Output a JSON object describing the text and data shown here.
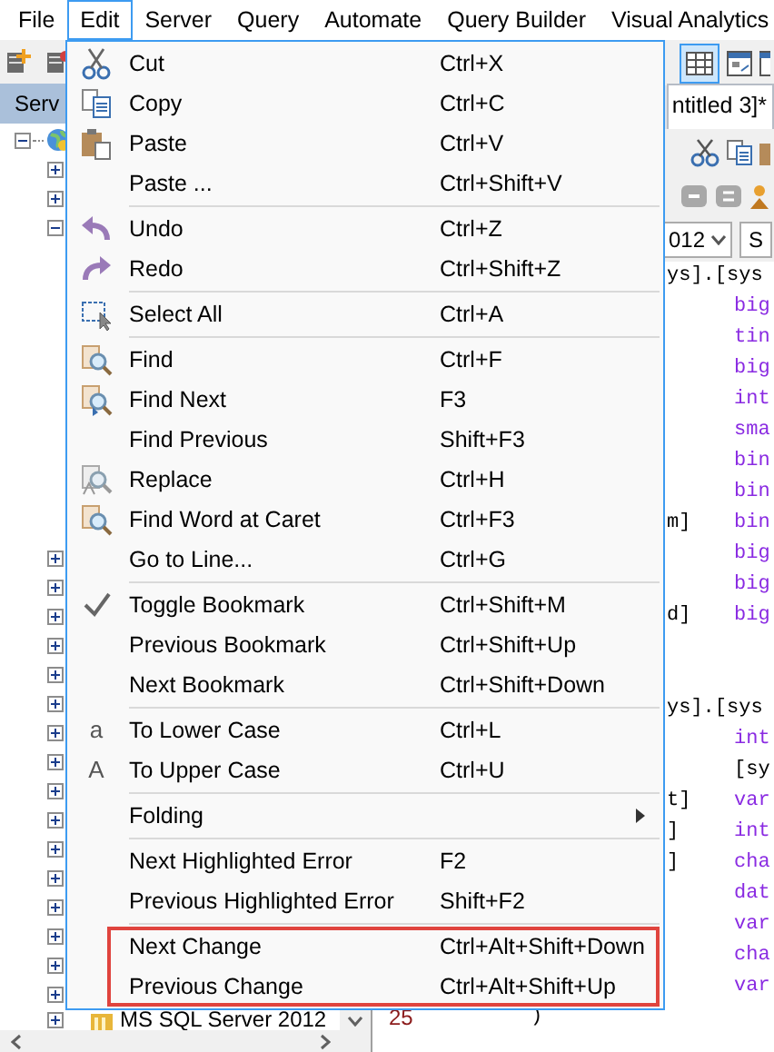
{
  "menubar": [
    {
      "label": "File",
      "selected": false
    },
    {
      "label": "Edit",
      "selected": true
    },
    {
      "label": "Server",
      "selected": false
    },
    {
      "label": "Query",
      "selected": false
    },
    {
      "label": "Automate",
      "selected": false
    },
    {
      "label": "Query Builder",
      "selected": false
    },
    {
      "label": "Visual Analytics",
      "selected": false
    }
  ],
  "left_panel": {
    "tab": "Serv",
    "tree": {
      "expanded": true,
      "children": [
        {
          "expanded": false
        },
        {
          "expanded": false
        },
        {
          "expanded": true
        },
        {
          "expanded": false
        },
        {
          "expanded": false
        },
        {
          "expanded": false
        },
        {
          "expanded": false
        },
        {
          "expanded": false
        },
        {
          "expanded": false
        },
        {
          "expanded": false
        },
        {
          "expanded": false
        },
        {
          "expanded": false
        },
        {
          "expanded": false
        },
        {
          "expanded": false
        },
        {
          "expanded": false
        },
        {
          "expanded": false
        },
        {
          "expanded": false
        },
        {
          "expanded": false
        },
        {
          "expanded": false
        },
        {
          "expanded": false,
          "label": "MS SQL Server 2012"
        }
      ]
    }
  },
  "document_tab": "ntitled 3]*",
  "version_select": {
    "value": "012"
  },
  "side_tab": "S",
  "editor": {
    "blocks": [
      {
        "lines": [
          {
            "a": "ys].[sys"
          },
          {
            "b": {
              "text": "big",
              "color": "#8a2be2"
            }
          },
          {
            "b": {
              "text": "tin",
              "color": "#8a2be2"
            }
          },
          {
            "b": {
              "text": "big",
              "color": "#8a2be2"
            }
          },
          {
            "b": {
              "text": "int",
              "color": "#8a2be2"
            }
          },
          {
            "b": {
              "text": "sma",
              "color": "#8a2be2"
            }
          },
          {
            "b": {
              "text": "bin",
              "color": "#8a2be2"
            }
          },
          {
            "b": {
              "text": "bin",
              "color": "#8a2be2"
            }
          },
          {
            "a": "m]",
            "b": {
              "text": "bin",
              "color": "#8a2be2"
            }
          },
          {
            "b": {
              "text": "big",
              "color": "#8a2be2"
            }
          },
          {
            "b": {
              "text": "big",
              "color": "#8a2be2"
            }
          },
          {
            "a": "d]",
            "b": {
              "text": "big",
              "color": "#8a2be2"
            }
          }
        ]
      },
      {
        "lines": [
          {
            "a": "ys].[sys"
          },
          {
            "b": {
              "text": "int",
              "color": "#8a2be2"
            }
          },
          {
            "b": {
              "text": "[sy",
              "color": "#000000"
            }
          },
          {
            "a": "t]",
            "b": {
              "text": "var",
              "color": "#8a2be2"
            }
          },
          {
            "a": "]",
            "b": {
              "text": "int",
              "color": "#8a2be2"
            }
          },
          {
            "a": "]",
            "b": {
              "text": "cha",
              "color": "#8a2be2"
            }
          },
          {
            "b": {
              "text": "dat",
              "color": "#8a2be2"
            }
          },
          {
            "b": {
              "text": "var",
              "color": "#8a2be2"
            }
          },
          {
            "b": {
              "text": "cha",
              "color": "#8a2be2"
            }
          },
          {
            "b": {
              "text": "var",
              "color": "#8a2be2"
            }
          },
          {
            "number": "25",
            "mid": ")"
          }
        ]
      }
    ]
  },
  "edit_menu": {
    "groups": [
      {
        "highlighted": false,
        "items": [
          {
            "label": "Cut",
            "shortcut": "Ctrl+X"
          },
          {
            "label": "Copy",
            "shortcut": "Ctrl+C"
          },
          {
            "label": "Paste",
            "shortcut": "Ctrl+V"
          },
          {
            "label": "Paste ...",
            "shortcut": "Ctrl+Shift+V"
          }
        ]
      },
      {
        "highlighted": false,
        "items": [
          {
            "label": "Undo",
            "shortcut": "Ctrl+Z"
          },
          {
            "label": "Redo",
            "shortcut": "Ctrl+Shift+Z"
          }
        ]
      },
      {
        "highlighted": false,
        "items": [
          {
            "label": "Select All",
            "shortcut": "Ctrl+A"
          }
        ]
      },
      {
        "highlighted": false,
        "items": [
          {
            "label": "Find",
            "shortcut": "Ctrl+F"
          },
          {
            "label": "Find Next",
            "shortcut": "F3"
          },
          {
            "label": "Find Previous",
            "shortcut": "Shift+F3"
          },
          {
            "label": "Replace",
            "shortcut": "Ctrl+H"
          },
          {
            "label": "Find Word at Caret",
            "shortcut": "Ctrl+F3"
          },
          {
            "label": "Go to Line...",
            "shortcut": "Ctrl+G"
          }
        ]
      },
      {
        "highlighted": false,
        "items": [
          {
            "label": "Toggle Bookmark",
            "shortcut": "Ctrl+Shift+M"
          },
          {
            "label": "Previous Bookmark",
            "shortcut": "Ctrl+Shift+Up"
          },
          {
            "label": "Next Bookmark",
            "shortcut": "Ctrl+Shift+Down"
          }
        ]
      },
      {
        "highlighted": false,
        "items": [
          {
            "label": "To Lower Case",
            "shortcut": "Ctrl+L",
            "icon_text": "a"
          },
          {
            "label": "To Upper Case",
            "shortcut": "Ctrl+U",
            "icon_text": "A"
          }
        ]
      },
      {
        "highlighted": false,
        "items": [
          {
            "label": "Folding",
            "submenu": true
          }
        ]
      },
      {
        "highlighted": false,
        "items": [
          {
            "label": "Next Highlighted Error",
            "shortcut": "F2"
          },
          {
            "label": "Previous Highlighted Error",
            "shortcut": "Shift+F2"
          }
        ]
      },
      {
        "highlighted": true,
        "items": [
          {
            "label": "Next Change",
            "shortcut": "Ctrl+Alt+Shift+Down"
          },
          {
            "label": "Previous Change",
            "shortcut": "Ctrl+Alt+Shift+Up"
          }
        ]
      }
    ]
  }
}
